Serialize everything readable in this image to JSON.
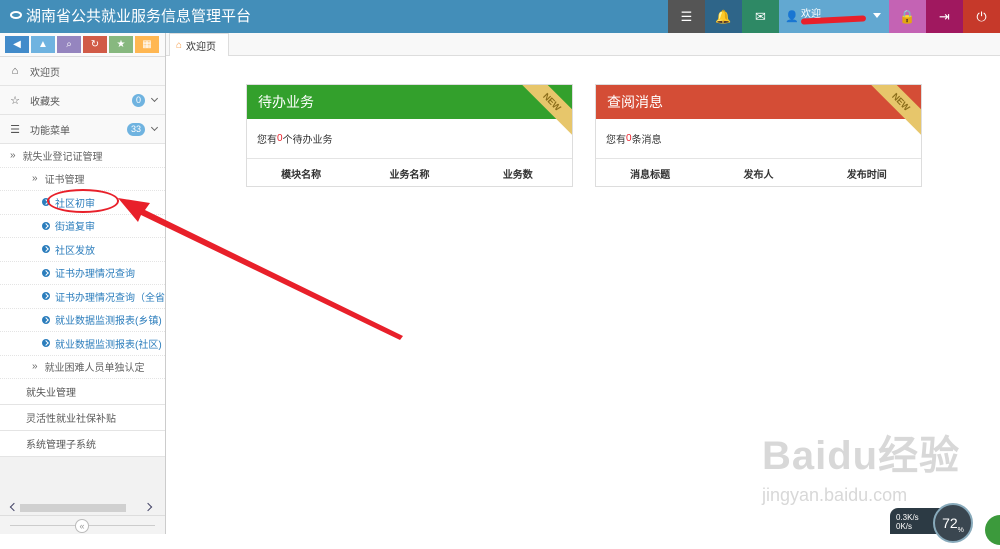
{
  "app": {
    "title": "湖南省公共就业服务信息管理平台"
  },
  "topnav": {
    "buttons": [
      {
        "name": "tasks-icon",
        "glyph": "☰",
        "color": "#555555"
      },
      {
        "name": "bell-icon",
        "glyph": "🔔",
        "color": "#2e6589"
      },
      {
        "name": "envelope-icon",
        "glyph": "✉",
        "color": "#2e8965"
      },
      {
        "name": "lock-icon",
        "glyph": "🔒",
        "color": "#c463b4"
      },
      {
        "name": "exit-icon",
        "glyph": "⇥",
        "color": "#a0185f"
      },
      {
        "name": "power-icon",
        "glyph": "⏻",
        "color": "#c6392a"
      }
    ],
    "user": {
      "greeting": "欢迎"
    }
  },
  "shortcuts": [
    {
      "name": "back-icon",
      "glyph": "◀",
      "color": "#428bca"
    },
    {
      "name": "up-icon",
      "glyph": "▲",
      "color": "#6fb3e0"
    },
    {
      "name": "search-icon",
      "glyph": "⌕",
      "color": "#9585bf"
    },
    {
      "name": "refresh-icon",
      "glyph": "↻",
      "color": "#d15b47"
    },
    {
      "name": "star-icon",
      "glyph": "★",
      "color": "#87b87f"
    },
    {
      "name": "grid-icon",
      "glyph": "▦",
      "color": "#ffb752"
    }
  ],
  "sidebar": {
    "home": {
      "label": "欢迎页",
      "icon": "home-icon"
    },
    "favorites": {
      "label": "收藏夹",
      "icon": "star-outline-icon",
      "count": "0"
    },
    "menu": {
      "label": "功能菜单",
      "icon": "list-icon",
      "count": "33"
    },
    "group": {
      "label": "就失业登记证管理"
    },
    "subgroup": {
      "label": "证书管理"
    },
    "leaves": [
      "社区初审",
      "街道复审",
      "社区发放",
      "证书办理情况查询",
      "证书办理情况查询（全省范",
      "就业数据监测报表(乡镇)",
      "就业数据监测报表(社区)"
    ],
    "subgroup2": {
      "label": "就业困难人员单独认定"
    },
    "others": [
      "就失业管理",
      "灵活性就业社保补贴",
      "系统管理子系统"
    ]
  },
  "tabs": [
    {
      "label": "欢迎页"
    }
  ],
  "cards": {
    "todo": {
      "title": "待办业务",
      "ribbon": "NEW",
      "color": "#33a02c",
      "info_prefix": "您有",
      "info_count": "0",
      "info_suffix": "个待办业务",
      "columns": [
        "模块名称",
        "业务名称",
        "业务数"
      ]
    },
    "messages": {
      "title": "查阅消息",
      "ribbon": "NEW",
      "color": "#d44d36",
      "info_prefix": "您有",
      "info_count": "0",
      "info_suffix": "条消息",
      "columns": [
        "消息标题",
        "发布人",
        "发布时间"
      ]
    }
  },
  "watermark": {
    "brand": "Baidu经验",
    "url": "jingyan.baidu.com"
  },
  "tray": {
    "speed_up": "0.3K/s",
    "speed_down": "0K/s",
    "percent": "72",
    "unit": "%"
  },
  "collapse": {
    "glyph": "«"
  }
}
